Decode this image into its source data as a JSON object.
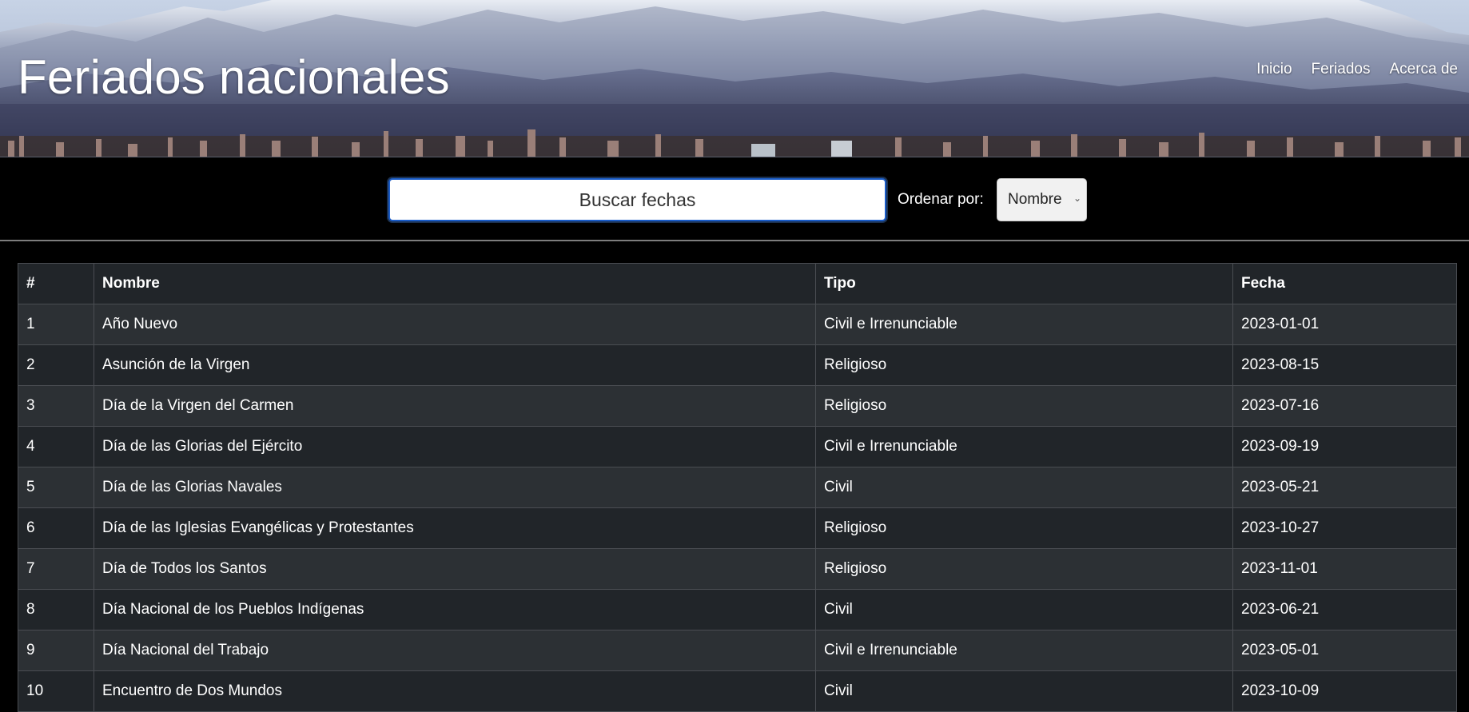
{
  "header": {
    "title": "Feriados nacionales",
    "nav": [
      "Inicio",
      "Feriados",
      "Acerca de"
    ]
  },
  "search": {
    "placeholder": "Buscar fechas",
    "sort_label": "Ordenar por:",
    "sort_selected": "Nombre"
  },
  "table": {
    "columns": [
      "#",
      "Nombre",
      "Tipo",
      "Fecha"
    ],
    "rows": [
      [
        "1",
        "Año Nuevo",
        "Civil e Irrenunciable",
        "2023-01-01"
      ],
      [
        "2",
        "Asunción de la Virgen",
        "Religioso",
        "2023-08-15"
      ],
      [
        "3",
        "Día de la Virgen del Carmen",
        "Religioso",
        "2023-07-16"
      ],
      [
        "4",
        "Día de las Glorias del Ejército",
        "Civil e Irrenunciable",
        "2023-09-19"
      ],
      [
        "5",
        "Día de las Glorias Navales",
        "Civil",
        "2023-05-21"
      ],
      [
        "6",
        "Día de las Iglesias Evangélicas y Protestantes",
        "Religioso",
        "2023-10-27"
      ],
      [
        "7",
        "Día de Todos los Santos",
        "Religioso",
        "2023-11-01"
      ],
      [
        "8",
        "Día Nacional de los Pueblos Indígenas",
        "Civil",
        "2023-06-21"
      ],
      [
        "9",
        "Día Nacional del Trabajo",
        "Civil e Irrenunciable",
        "2023-05-01"
      ],
      [
        "10",
        "Encuentro de Dos Mundos",
        "Civil",
        "2023-10-09"
      ]
    ]
  },
  "colors": {
    "page_background": "#000000",
    "table_row_odd": "#2c3034",
    "table_row_even": "#212529",
    "input_focus_border": "#1a5cc8"
  }
}
